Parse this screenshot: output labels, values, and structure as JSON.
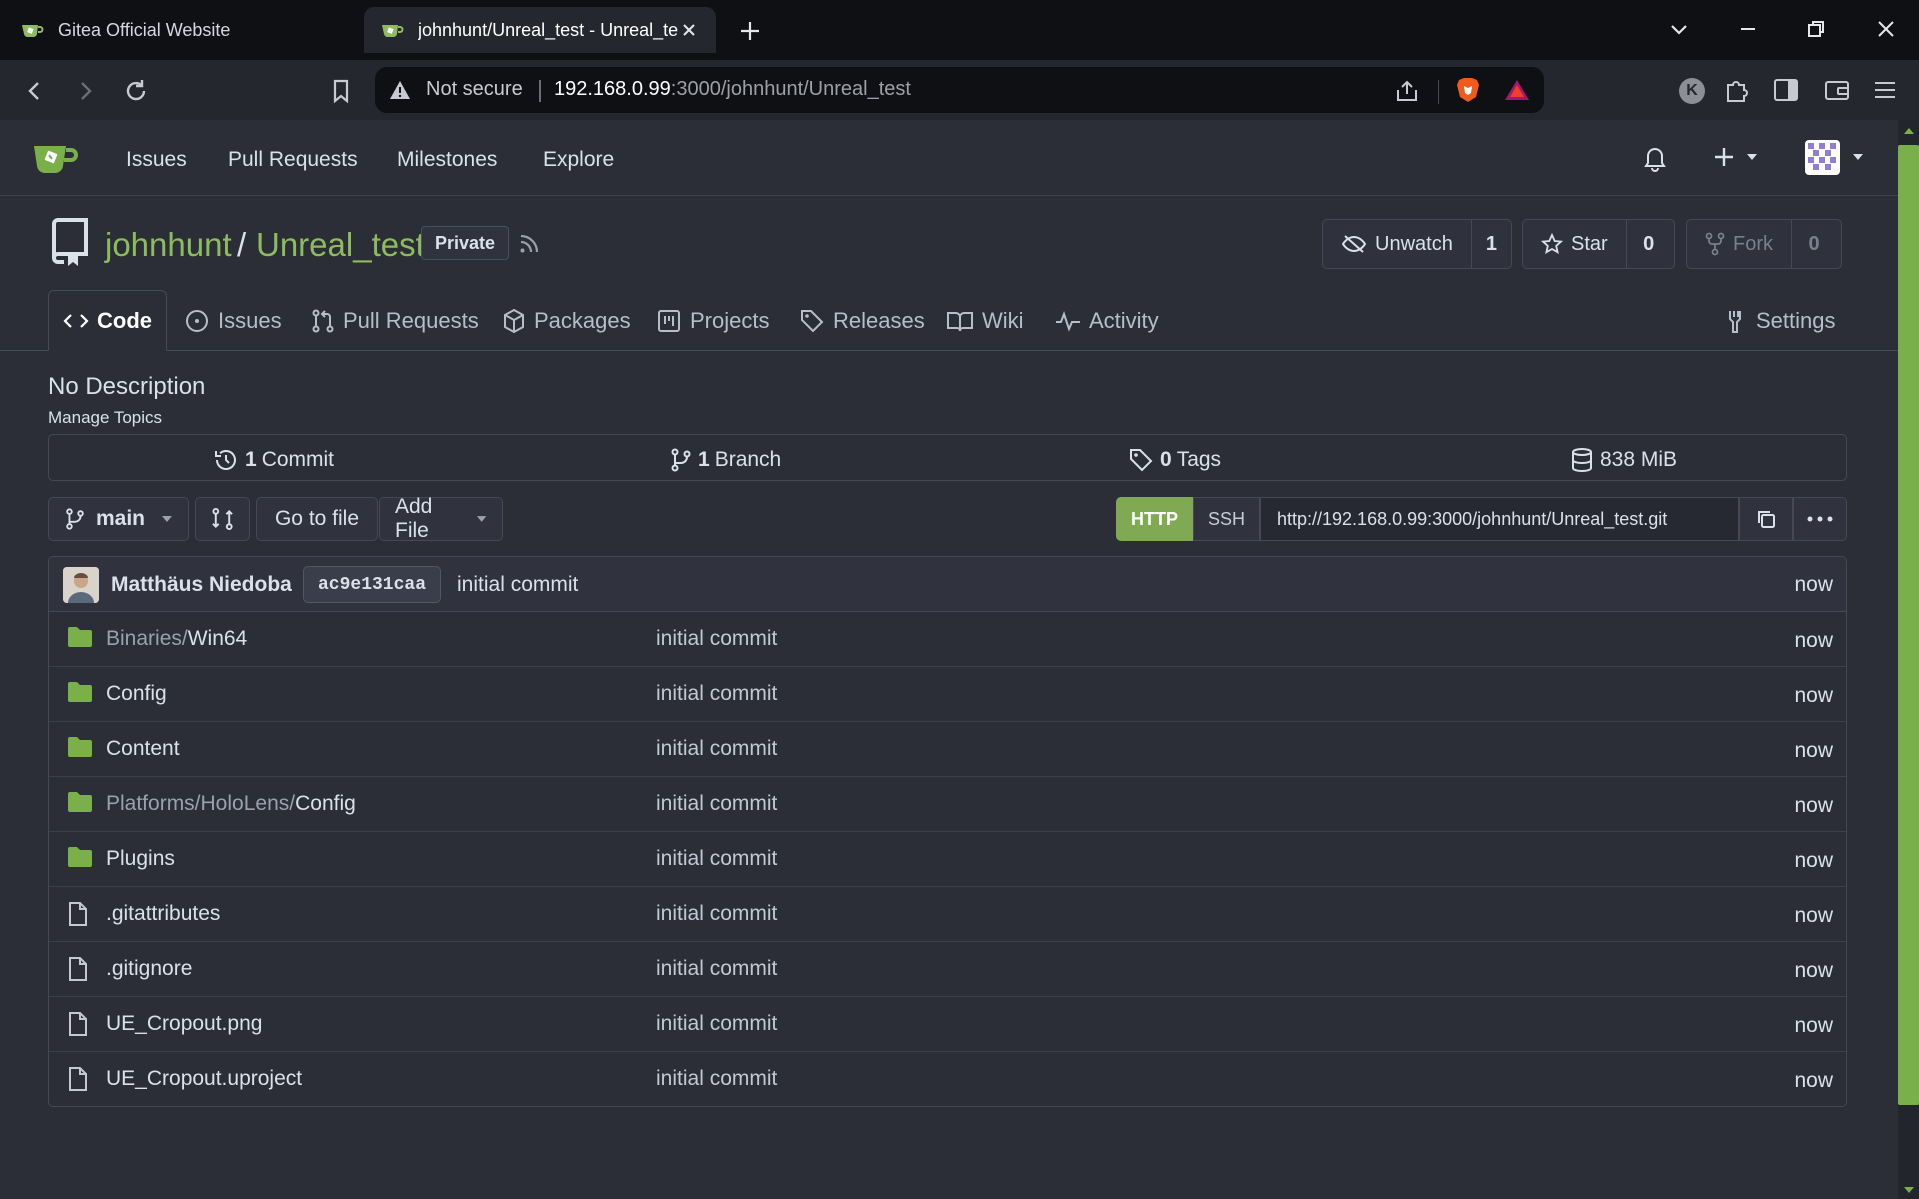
{
  "browser": {
    "tabs": [
      {
        "title": "Gitea Official Website",
        "active": false
      },
      {
        "title": "johnhunt/Unreal_test - Unreal_test",
        "active": true
      }
    ],
    "address": {
      "security": "Not secure",
      "host": "192.168.0.99",
      "rest": ":3000/johnhunt/Unreal_test"
    },
    "profile_initial": "K"
  },
  "gitea_nav": {
    "items": [
      "Issues",
      "Pull Requests",
      "Milestones",
      "Explore"
    ]
  },
  "repo": {
    "owner": "johnhunt",
    "separator": "/",
    "name": "Unreal_test",
    "visibility": "Private",
    "watch": {
      "label": "Unwatch",
      "count": "1"
    },
    "star": {
      "label": "Star",
      "count": "0"
    },
    "fork": {
      "label": "Fork",
      "count": "0"
    },
    "tabs": [
      {
        "label": "Code",
        "icon": "code-icon"
      },
      {
        "label": "Issues",
        "icon": "issue-icon"
      },
      {
        "label": "Pull Requests",
        "icon": "pull-request-icon"
      },
      {
        "label": "Packages",
        "icon": "package-icon"
      },
      {
        "label": "Projects",
        "icon": "project-icon"
      },
      {
        "label": "Releases",
        "icon": "tag-icon"
      },
      {
        "label": "Wiki",
        "icon": "book-icon"
      },
      {
        "label": "Activity",
        "icon": "pulse-icon"
      }
    ],
    "settings_label": "Settings",
    "description": "No Description",
    "manage_topics": "Manage Topics",
    "stats": {
      "commits": {
        "count": "1",
        "label": "Commit"
      },
      "branches": {
        "count": "1",
        "label": "Branch"
      },
      "tags": {
        "count": "0",
        "label": "Tags"
      },
      "size": "838 MiB"
    },
    "branch": "main",
    "go_to_file": "Go to file",
    "add_file": "Add File",
    "clone": {
      "http": "HTTP",
      "ssh": "SSH",
      "url": "http://192.168.0.99:3000/johnhunt/Unreal_test.git"
    },
    "latest_commit": {
      "author": "Matthäus Niedoba",
      "sha": "ac9e131caa",
      "message": "initial commit",
      "time": "now"
    },
    "files": [
      {
        "type": "dir",
        "prefix": "Binaries/",
        "name": "Win64",
        "message": "initial commit",
        "time": "now"
      },
      {
        "type": "dir",
        "prefix": "",
        "name": "Config",
        "message": "initial commit",
        "time": "now"
      },
      {
        "type": "dir",
        "prefix": "",
        "name": "Content",
        "message": "initial commit",
        "time": "now"
      },
      {
        "type": "dir",
        "prefix": "Platforms/HoloLens/",
        "name": "Config",
        "message": "initial commit",
        "time": "now"
      },
      {
        "type": "dir",
        "prefix": "",
        "name": "Plugins",
        "message": "initial commit",
        "time": "now"
      },
      {
        "type": "file",
        "prefix": "",
        "name": ".gitattributes",
        "message": "initial commit",
        "time": "now"
      },
      {
        "type": "file",
        "prefix": "",
        "name": ".gitignore",
        "message": "initial commit",
        "time": "now"
      },
      {
        "type": "file",
        "prefix": "",
        "name": "UE_Cropout.png",
        "message": "initial commit",
        "time": "now"
      },
      {
        "type": "file",
        "prefix": "",
        "name": "UE_Cropout.uproject",
        "message": "initial commit",
        "time": "now"
      }
    ]
  },
  "colors": {
    "accent_green": "#8fbb5f",
    "http_button": "#7fa952",
    "folder": "#7ab04a",
    "page_bg": "#2b2e37"
  }
}
